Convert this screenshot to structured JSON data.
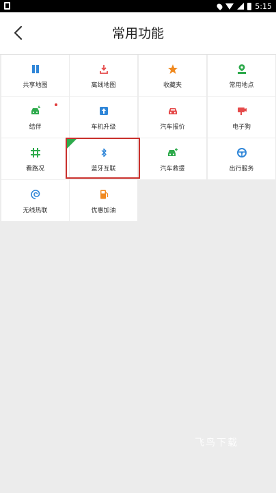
{
  "status_bar": {
    "time": "5:15"
  },
  "header": {
    "title": "常用功能"
  },
  "features": [
    {
      "label": "共享地图",
      "icon": "map-icon",
      "color": "#2f86d8"
    },
    {
      "label": "离线地图",
      "icon": "download-icon",
      "color": "#e54a4a"
    },
    {
      "label": "收藏夹",
      "icon": "star-icon",
      "color": "#f0891f"
    },
    {
      "label": "常用地点",
      "icon": "location-pin-icon",
      "color": "#2eaa4c"
    },
    {
      "label": "结伴",
      "icon": "car-companion-icon",
      "color": "#2eaa4c"
    },
    {
      "label": "车机升级",
      "icon": "upgrade-icon",
      "color": "#2f86d8"
    },
    {
      "label": "汽车报价",
      "icon": "car-price-icon",
      "color": "#e54a4a"
    },
    {
      "label": "电子狗",
      "icon": "camera-icon",
      "color": "#e54a4a"
    },
    {
      "label": "看路况",
      "icon": "traffic-icon",
      "color": "#2eaa4c"
    },
    {
      "label": "蓝牙互联",
      "icon": "bluetooth-icon",
      "color": "#2f86d8"
    },
    {
      "label": "汽车救援",
      "icon": "car-rescue-icon",
      "color": "#2eaa4c"
    },
    {
      "label": "出行服务",
      "icon": "steering-wheel-icon",
      "color": "#2f86d8"
    },
    {
      "label": "无线热联",
      "icon": "wireless-icon",
      "color": "#2f86d8"
    },
    {
      "label": "优惠加油",
      "icon": "fuel-icon",
      "color": "#f0891f"
    }
  ],
  "watermark": "飞鸟下载"
}
